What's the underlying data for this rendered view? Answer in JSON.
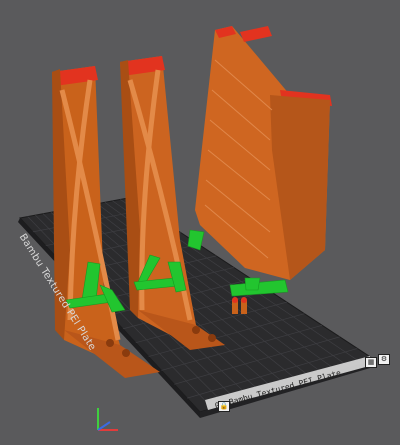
{
  "viewport": {
    "plate_name": "Bambu Textured PEI Plate",
    "plate_label": "01 Bambu Textured PEI Plate",
    "colors": {
      "background": "#5a5a5c",
      "plate": "#2b2b2d",
      "grid": "#3d3d40",
      "model": "#d2691e",
      "model_top": "#e03030",
      "support": "#22c52f"
    },
    "plate_buttons": [
      "plate-lock-icon",
      "plate-settings-icon"
    ],
    "axis_gizmo": [
      "x-axis",
      "y-axis",
      "z-axis"
    ]
  }
}
